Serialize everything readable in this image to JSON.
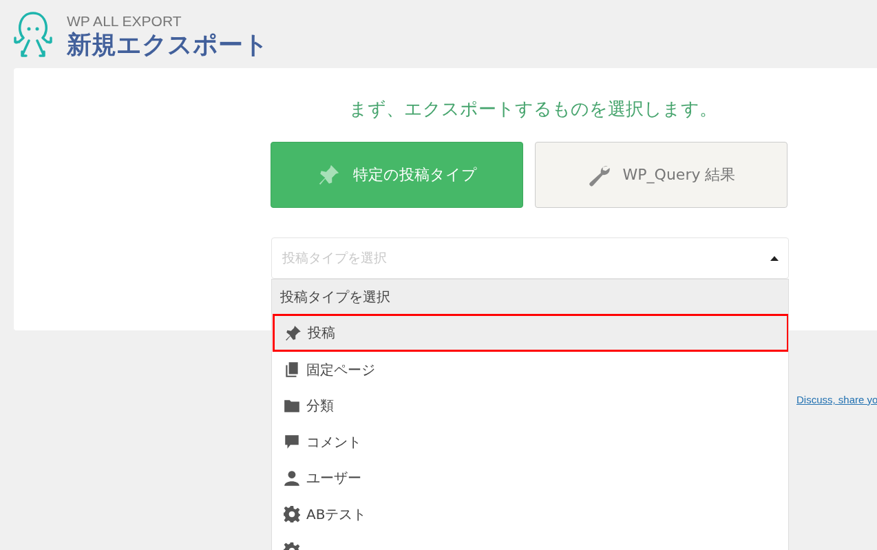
{
  "header": {
    "brand": "WP ALL EXPORT",
    "title": "新規エクスポート"
  },
  "heading": "まず、エクスポートするものを選択します。",
  "export_types": [
    {
      "label": "特定の投稿タイプ",
      "kind": "pin",
      "selected": true
    },
    {
      "label": "WP_Query 結果",
      "kind": "wrench",
      "selected": false
    }
  ],
  "post_type_select": {
    "placeholder": "投稿タイプを選択",
    "expanded": true,
    "options": [
      {
        "label": "投稿タイプを選択",
        "kind": "none",
        "highlighted": true,
        "outlined": false
      },
      {
        "label": "投稿",
        "kind": "pin",
        "highlighted": true,
        "outlined": true
      },
      {
        "label": "固定ページ",
        "kind": "pages",
        "highlighted": false,
        "outlined": false
      },
      {
        "label": "分類",
        "kind": "folder",
        "highlighted": false,
        "outlined": false
      },
      {
        "label": "コメント",
        "kind": "comment",
        "highlighted": false,
        "outlined": false
      },
      {
        "label": "ユーザー",
        "kind": "user",
        "highlighted": false,
        "outlined": false
      },
      {
        "label": "ABテスト",
        "kind": "gear",
        "highlighted": false,
        "outlined": false
      },
      {
        "kind": "gear",
        "highlighted": false,
        "outlined": false
      }
    ]
  },
  "footer_link": "Discuss, share yo"
}
